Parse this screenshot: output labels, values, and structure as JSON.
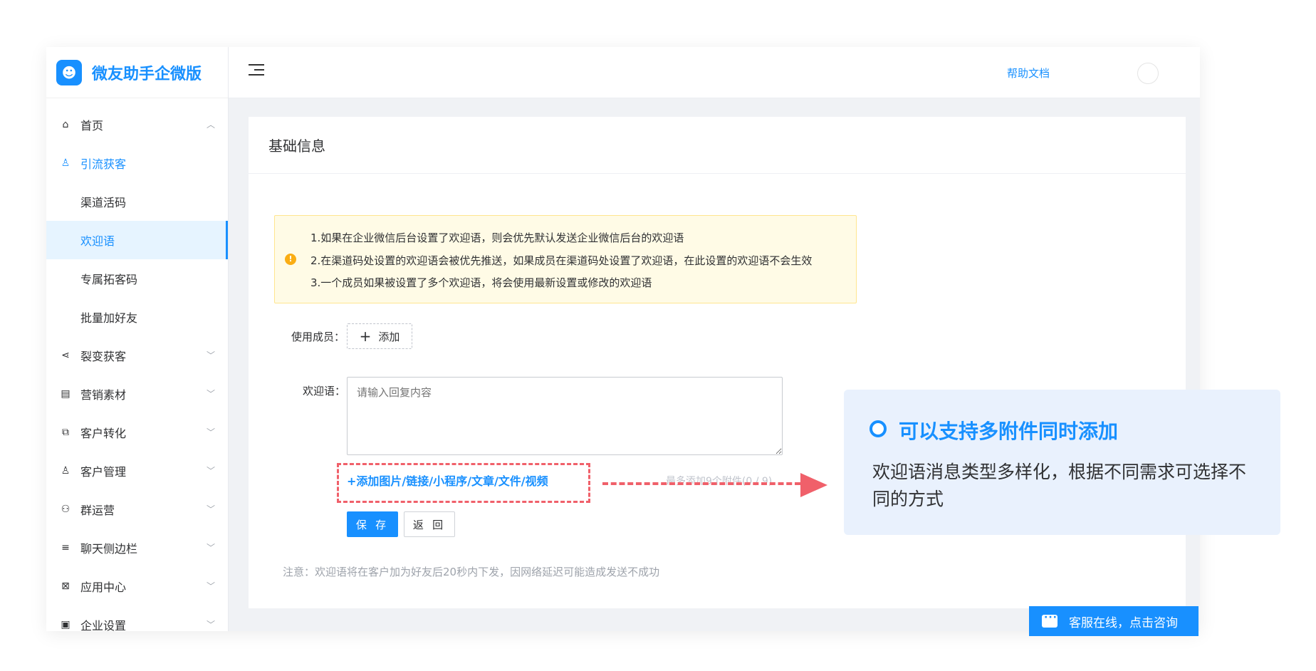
{
  "app": {
    "name": "微友助手企微版"
  },
  "header": {
    "help_label": "帮助文档"
  },
  "sidebar": {
    "items": [
      {
        "label": "首页",
        "icon": "home-icon"
      },
      {
        "label": "引流获客",
        "icon": "user-icon"
      },
      {
        "label": "裂变获客",
        "icon": "share-icon"
      },
      {
        "label": "营销素材",
        "icon": "document-icon"
      },
      {
        "label": "客户转化",
        "icon": "convert-icon"
      },
      {
        "label": "客户管理",
        "icon": "user-icon"
      },
      {
        "label": "群运营",
        "icon": "group-icon"
      },
      {
        "label": "聊天侧边栏",
        "icon": "sidebar-icon"
      },
      {
        "label": "应用中心",
        "icon": "apps-icon"
      },
      {
        "label": "企业设置",
        "icon": "settings-icon"
      }
    ],
    "sub_items": [
      {
        "label": "渠道活码"
      },
      {
        "label": "欢迎语",
        "selected": true
      },
      {
        "label": "专属拓客码"
      },
      {
        "label": "批量加好友"
      }
    ]
  },
  "main": {
    "card_title": "基础信息",
    "alert_lines": [
      "1.如果在企业微信后台设置了欢迎语，则会优先默认发送企业微信后台的欢迎语",
      "2.在渠道码处设置的欢迎语会被优先推送，如果成员在渠道码处设置了欢迎语，在此设置的欢迎语不会生效",
      "3.一个成员如果被设置了多个欢迎语，将会使用最新设置或修改的欢迎语"
    ],
    "members_label": "使用成员：",
    "add_label": "添加",
    "welcome_label": "欢迎语：",
    "welcome_placeholder": "请输入回复内容",
    "attach_link": "+添加图片/链接/小程序/文章/文件/视频",
    "attach_hint": "最多添加9个附件(0 / 9)",
    "save_label": "保 存",
    "back_label": "返 回",
    "note": "注意：欢迎语将在客户加为好友后20秒内下发，因网络延迟可能造成发送不成功"
  },
  "chat": {
    "label": "客服在线，点击咨询"
  },
  "callout": {
    "title": "可以支持多附件同时添加",
    "body": "欢迎语消息类型多样化，根据不同需求可选择不同的方式"
  },
  "colors": {
    "accent": "#1890ff",
    "highlight": "#f0606a",
    "alert_bg": "#fffbe6",
    "callout_bg": "#e9f1fd"
  }
}
